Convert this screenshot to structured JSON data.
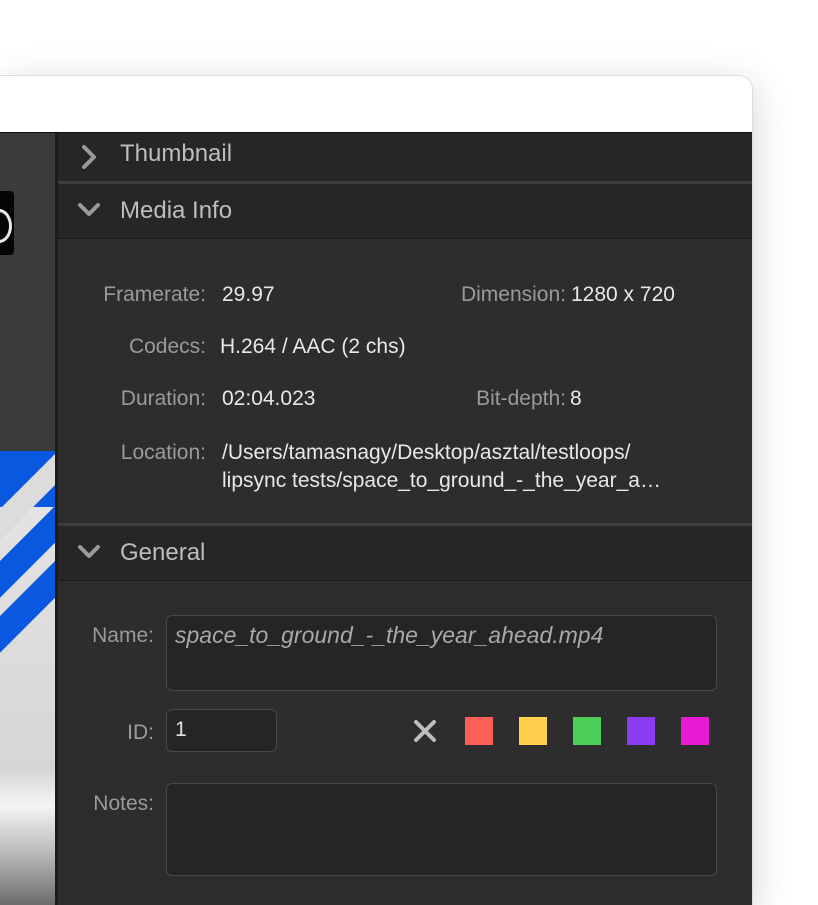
{
  "inspector": {
    "sections": {
      "thumbnail": {
        "label": "Thumbnail",
        "expanded": false
      },
      "media_info": {
        "label": "Media Info",
        "expanded": true
      },
      "general": {
        "label": "General",
        "expanded": true
      }
    },
    "media_info": {
      "framerate_label": "Framerate:",
      "framerate_value": "29.97",
      "dimension_label": "Dimension:",
      "dimension_value": "1280 x 720",
      "codecs_label": "Codecs:",
      "codecs_value": "H.264 / AAC (2 chs)",
      "duration_label": "Duration:",
      "duration_value": "02:04.023",
      "bitdepth_label": "Bit-depth:",
      "bitdepth_value": "8",
      "location_label": "Location:",
      "location_line1": "/Users/tamasnagy/Desktop/asztal/testloops/",
      "location_line2": "lipsync tests/space_to_ground_-_the_year_a…"
    },
    "general": {
      "name_label": "Name:",
      "name_value": "space_to_ground_-_the_year_ahead.mp4",
      "id_label": "ID:",
      "id_value": "1",
      "notes_label": "Notes:",
      "notes_value": "",
      "color_tags": [
        "#ff5f56",
        "#ffcf4d",
        "#4fcf5a",
        "#8a3cf2",
        "#e81bd2"
      ]
    }
  }
}
